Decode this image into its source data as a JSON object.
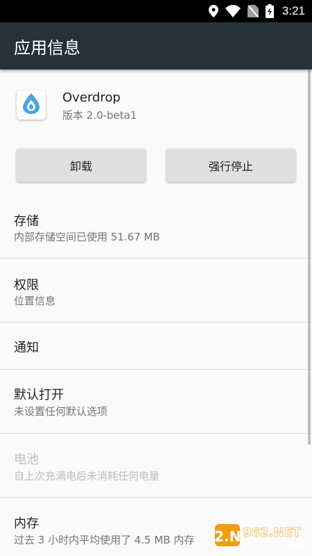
{
  "status_bar": {
    "time": "3:21"
  },
  "app_bar": {
    "title": "应用信息"
  },
  "app": {
    "name": "Overdrop",
    "version": "版本 2.0-beta1"
  },
  "buttons": {
    "uninstall": "卸载",
    "force_stop": "强行停止"
  },
  "items": [
    {
      "title": "存储",
      "subtitle": "内部存储空间已使用 51.67 MB",
      "enabled": true
    },
    {
      "title": "权限",
      "subtitle": "位置信息",
      "enabled": true
    },
    {
      "title": "通知",
      "subtitle": "",
      "enabled": true
    },
    {
      "title": "默认打开",
      "subtitle": "未设置任何默认选项",
      "enabled": true
    },
    {
      "title": "电池",
      "subtitle": "自上次充满电后未消耗任何电量",
      "enabled": false
    },
    {
      "title": "内存",
      "subtitle": "过去 3 小时内平均使用了 4.5 MB 内存",
      "enabled": true
    }
  ],
  "watermark": {
    "text": "962.NET",
    "subtext": "乐游网"
  },
  "colors": {
    "app_bar": "#263238",
    "status_bar": "#000000",
    "button": "#e0e0e0",
    "icon_accent": "#4ba3e3"
  },
  "icons": [
    "location-icon",
    "wifi-icon",
    "no-sim-icon",
    "battery-charging-icon",
    "water-drop-icon"
  ]
}
